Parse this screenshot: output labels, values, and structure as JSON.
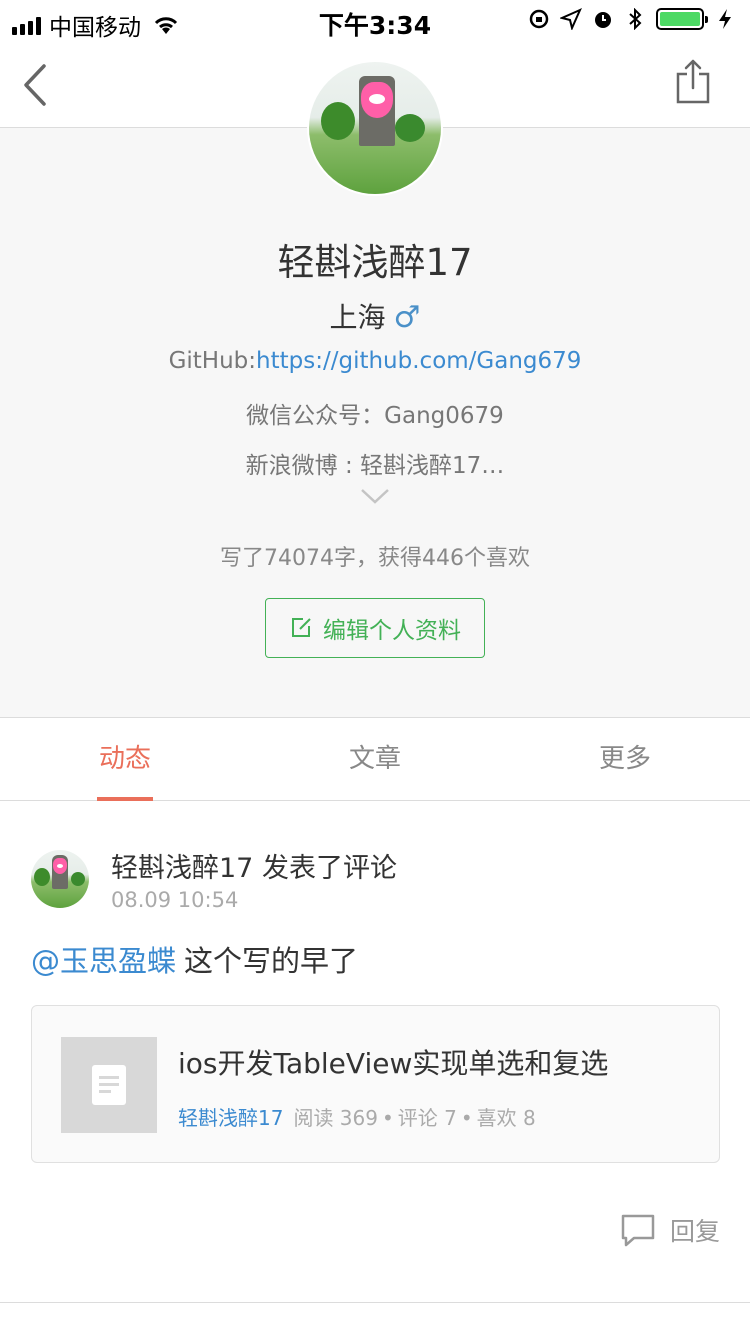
{
  "status_bar": {
    "carrier": "中国移动",
    "time": "下午3:34",
    "battery_color": "#4cd964"
  },
  "nav": {
    "back_icon": "chevron-left-icon",
    "share_icon": "share-icon"
  },
  "profile": {
    "name": "轻斟浅醉17",
    "location": "上海",
    "gender_symbol": "♂",
    "github_label": "GitHub:",
    "github_url": "https://github.com/Gang679",
    "wechat": "微信公众号：Gang0679",
    "weibo": "新浪微博 : 轻斟浅醉17…",
    "stats": "写了74074字，获得446个喜欢",
    "edit_button": "编辑个人资料"
  },
  "tabs": [
    {
      "label": "动态",
      "active": true
    },
    {
      "label": "文章",
      "active": false
    },
    {
      "label": "更多",
      "active": false
    }
  ],
  "feed": {
    "item": {
      "title": "轻斟浅醉17 发表了评论",
      "time": "08.09 10:54",
      "mention": "@玉思盈蝶",
      "comment": "这个写的早了",
      "article": {
        "title": "ios开发TableView实现单选和复选",
        "author": "轻斟浅醉17",
        "reads": "阅读 369",
        "comments": "评论 7",
        "likes": "喜欢 8"
      },
      "reply_label": "回复"
    }
  },
  "colors": {
    "accent": "#ea6f5a",
    "link": "#3b8ad0",
    "green": "#43b156"
  }
}
